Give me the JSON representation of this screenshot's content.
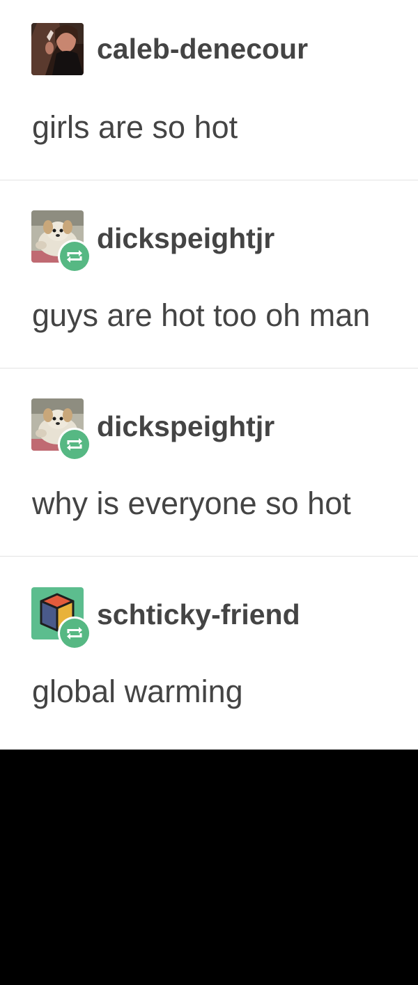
{
  "posts": [
    {
      "username": "caleb-denecour",
      "text": "girls are so hot",
      "avatar_icon": "photo-avatar-woman-icon",
      "reblog": false
    },
    {
      "username": "dickspeightjr",
      "text": "guys are hot too oh man",
      "avatar_icon": "photo-avatar-dog-icon",
      "reblog": true
    },
    {
      "username": "dickspeightjr",
      "text": "why is everyone so hot",
      "avatar_icon": "photo-avatar-dog-icon",
      "reblog": true
    },
    {
      "username": "schticky-friend",
      "text": "global warming",
      "avatar_icon": "cube-avatar-icon",
      "reblog": true
    }
  ],
  "colors": {
    "background": "#ffffff",
    "text": "#444444",
    "divider": "#e3e3e3",
    "reblog_green": "#56b883",
    "cube_avatar_bg": "#5cbd8e",
    "letterbox": "#000000"
  }
}
